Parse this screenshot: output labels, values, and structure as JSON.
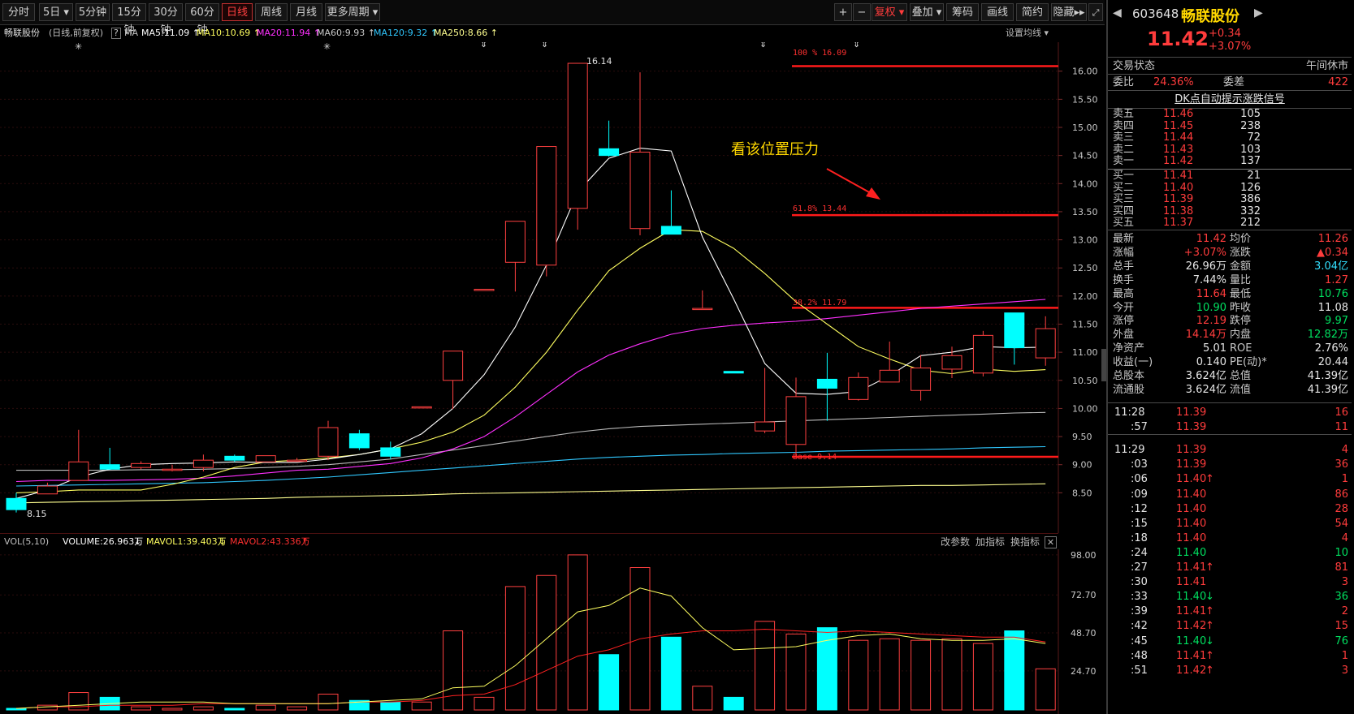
{
  "toolbar": {
    "periods": [
      "分时",
      "5日",
      "5分钟",
      "15分钟",
      "30分钟",
      "60分钟",
      "日线",
      "周线",
      "月线",
      "更多周期"
    ],
    "active": "日线",
    "right_buttons": [
      "+",
      "−",
      "复权",
      "叠加",
      "筹码",
      "画线",
      "简约",
      "隐藏"
    ]
  },
  "legend": {
    "stock": "畅联股份",
    "mode": "(日线,前复权)",
    "q": "?",
    "ma": "MA",
    "ma5": "MA5:11.09",
    "ma10": "MA10:10.69",
    "ma20": "MA20:11.94",
    "ma60": "MA60:9.93",
    "ma120": "MA120:9.32",
    "ma250": "MA250:8.66",
    "setting": "设置均线"
  },
  "price_axis": [
    "16.00",
    "15.50",
    "15.00",
    "14.50",
    "14.00",
    "13.50",
    "13.00",
    "12.50",
    "12.00",
    "11.50",
    "11.00",
    "10.50",
    "10.00",
    "9.50",
    "9.00",
    "8.50"
  ],
  "annotations": {
    "high": "16.14",
    "low": "8.15",
    "note": "看该位置压力",
    "fib100": "100 % 16.09",
    "fib618": "61.8% 13.44",
    "fib382": "38.2% 11.79",
    "base": "Base  9.14"
  },
  "colors": {
    "up": "#ff4040",
    "down": "#00ffff",
    "ma5": "#ffffff",
    "ma10": "#ffff60",
    "ma20": "#ff30ff",
    "ma60": "#bbbbbb",
    "ma120": "#30c8ff",
    "ma250": "#ffff90"
  },
  "chart_data": {
    "type": "candlestick",
    "candles": [
      {
        "o": 8.4,
        "h": 8.5,
        "l": 8.15,
        "c": 8.2
      },
      {
        "o": 8.48,
        "h": 8.68,
        "l": 8.48,
        "c": 8.62
      },
      {
        "o": 8.72,
        "h": 9.62,
        "l": 8.72,
        "c": 9.05
      },
      {
        "o": 9.0,
        "h": 9.3,
        "l": 8.92,
        "c": 8.92
      },
      {
        "o": 8.95,
        "h": 9.06,
        "l": 8.92,
        "c": 9.02
      },
      {
        "o": 8.9,
        "h": 9.0,
        "l": 8.88,
        "c": 8.92
      },
      {
        "o": 8.95,
        "h": 9.18,
        "l": 8.88,
        "c": 9.08
      },
      {
        "o": 9.15,
        "h": 9.18,
        "l": 9.05,
        "c": 9.08
      },
      {
        "o": 9.05,
        "h": 9.16,
        "l": 9.05,
        "c": 9.16
      },
      {
        "o": 9.06,
        "h": 9.12,
        "l": 9.05,
        "c": 9.08
      },
      {
        "o": 9.15,
        "h": 9.78,
        "l": 9.08,
        "c": 9.66
      },
      {
        "o": 9.55,
        "h": 9.62,
        "l": 9.26,
        "c": 9.3
      },
      {
        "o": 9.3,
        "h": 9.41,
        "l": 9.1,
        "c": 9.15
      },
      {
        "o": 10.03,
        "h": 10.03,
        "l": 10.03,
        "c": 10.03
      },
      {
        "o": 10.5,
        "h": 11.02,
        "l": 9.99,
        "c": 11.02
      },
      {
        "o": 12.1,
        "h": 12.1,
        "l": 12.1,
        "c": 12.12
      },
      {
        "o": 12.6,
        "h": 13.33,
        "l": 12.08,
        "c": 13.33
      },
      {
        "o": 12.55,
        "h": 14.66,
        "l": 12.35,
        "c": 14.66
      },
      {
        "o": 13.56,
        "h": 16.14,
        "l": 13.18,
        "c": 16.14
      },
      {
        "o": 14.62,
        "h": 15.12,
        "l": 14.48,
        "c": 14.5
      },
      {
        "o": 13.2,
        "h": 15.98,
        "l": 13.08,
        "c": 14.56
      },
      {
        "o": 13.24,
        "h": 13.88,
        "l": 13.1,
        "c": 13.1
      },
      {
        "o": 11.78,
        "h": 12.1,
        "l": 11.78,
        "c": 11.78
      },
      {
        "o": 10.66,
        "h": 10.66,
        "l": 10.63,
        "c": 10.63
      },
      {
        "o": 9.6,
        "h": 10.72,
        "l": 9.56,
        "c": 9.76
      },
      {
        "o": 9.36,
        "h": 10.55,
        "l": 9.15,
        "c": 10.21
      },
      {
        "o": 10.52,
        "h": 10.99,
        "l": 9.78,
        "c": 10.36
      },
      {
        "o": 10.16,
        "h": 10.64,
        "l": 10.14,
        "c": 10.55
      },
      {
        "o": 10.47,
        "h": 11.19,
        "l": 10.47,
        "c": 10.68
      },
      {
        "o": 10.32,
        "h": 10.95,
        "l": 10.14,
        "c": 10.72
      },
      {
        "o": 10.7,
        "h": 11.1,
        "l": 10.54,
        "c": 10.94
      },
      {
        "o": 10.63,
        "h": 11.38,
        "l": 10.57,
        "c": 11.3
      },
      {
        "o": 11.7,
        "h": 11.7,
        "l": 10.78,
        "c": 11.08
      },
      {
        "o": 10.9,
        "h": 11.64,
        "l": 10.76,
        "c": 11.42
      }
    ],
    "ma5": [
      8.4,
      8.55,
      8.78,
      8.92,
      9.0,
      9.02,
      9.03,
      9.05,
      9.04,
      9.04,
      9.1,
      9.18,
      9.28,
      9.55,
      10.0,
      10.6,
      11.45,
      12.55,
      13.85,
      14.45,
      14.63,
      14.58,
      13.05,
      11.95,
      10.8,
      10.27,
      10.25,
      10.3,
      10.58,
      10.94,
      11.0,
      11.1,
      11.08,
      11.09
    ],
    "ma10": [
      8.5,
      8.52,
      8.55,
      8.55,
      8.55,
      8.65,
      8.78,
      8.95,
      9.05,
      9.08,
      9.12,
      9.18,
      9.28,
      9.4,
      9.58,
      9.88,
      10.38,
      11.0,
      11.75,
      12.45,
      12.85,
      13.18,
      13.15,
      12.85,
      12.4,
      11.9,
      11.5,
      11.1,
      10.88,
      10.68,
      10.62,
      10.7,
      10.66,
      10.69
    ],
    "ma20": [
      8.7,
      8.72,
      8.72,
      8.72,
      8.73,
      8.74,
      8.76,
      8.8,
      8.85,
      8.9,
      8.92,
      8.97,
      9.02,
      9.12,
      9.28,
      9.5,
      9.85,
      10.25,
      10.65,
      10.95,
      11.15,
      11.32,
      11.42,
      11.48,
      11.52,
      11.55,
      11.6,
      11.66,
      11.72,
      11.78,
      11.82,
      11.86,
      11.9,
      11.94
    ],
    "ma60": [
      8.9,
      8.9,
      8.9,
      8.9,
      8.91,
      8.91,
      8.92,
      8.93,
      8.95,
      8.97,
      9.0,
      9.05,
      9.1,
      9.18,
      9.26,
      9.34,
      9.42,
      9.5,
      9.58,
      9.64,
      9.68,
      9.7,
      9.72,
      9.74,
      9.76,
      9.78,
      9.8,
      9.82,
      9.84,
      9.86,
      9.88,
      9.9,
      9.92,
      9.93
    ],
    "ma120": [
      8.62,
      8.63,
      8.64,
      8.65,
      8.66,
      8.67,
      8.68,
      8.7,
      8.72,
      8.75,
      8.78,
      8.82,
      8.86,
      8.9,
      8.94,
      8.98,
      9.02,
      9.06,
      9.1,
      9.13,
      9.15,
      9.17,
      9.18,
      9.2,
      9.21,
      9.22,
      9.24,
      9.25,
      9.26,
      9.27,
      9.28,
      9.3,
      9.31,
      9.32
    ],
    "ma250": [
      8.32,
      8.33,
      8.34,
      8.35,
      8.36,
      8.37,
      8.38,
      8.39,
      8.4,
      8.42,
      8.43,
      8.44,
      8.45,
      8.46,
      8.48,
      8.49,
      8.5,
      8.51,
      8.52,
      8.53,
      8.54,
      8.55,
      8.56,
      8.57,
      8.58,
      8.59,
      8.6,
      8.61,
      8.62,
      8.63,
      8.63,
      8.64,
      8.65,
      8.66
    ],
    "fib_levels": [
      16.09,
      13.44,
      11.79,
      9.14
    ],
    "price_ylim": [
      8.0,
      16.4
    ],
    "volume_axis": [
      "98.00",
      "72.70",
      "48.70",
      "24.70"
    ],
    "volume_ylim": [
      0,
      100
    ],
    "volume": [
      1,
      3,
      11,
      8,
      2,
      1,
      2,
      1,
      3,
      2,
      10,
      6,
      5,
      5,
      50,
      8,
      78,
      85,
      98,
      35,
      90,
      46,
      15,
      8,
      56,
      48,
      52,
      44,
      45,
      44,
      45,
      42,
      50,
      26
    ],
    "mavol1": [
      1,
      2,
      3,
      4,
      5,
      5,
      5,
      4,
      4,
      4,
      4,
      5,
      6,
      7,
      14,
      15,
      28,
      45,
      62,
      66,
      77,
      72,
      52,
      38,
      39,
      40,
      44,
      47,
      48,
      45,
      44,
      44,
      45,
      42
    ],
    "mavol2": [
      1,
      2,
      2,
      3,
      3,
      3,
      4,
      4,
      4,
      4,
      4,
      5,
      5,
      6,
      9,
      10,
      16,
      25,
      34,
      38,
      45,
      48,
      50,
      50,
      51,
      50,
      49,
      50,
      49,
      48,
      47,
      46,
      46,
      43
    ]
  },
  "volume_legend": {
    "vol": "VOL(5,10)",
    "volume": "VOLUME:26.963万",
    "mavol1": "MAVOL1:39.403万",
    "mavol2": "MAVOL2:43.336万",
    "edit": "改参数",
    "add": "加指标",
    "switch": "换指标",
    "close": "✕"
  },
  "quote": {
    "code": "603648",
    "name": "畅联股份",
    "price": "11.42",
    "change": "+0.34",
    "pct": "+3.07%",
    "status_label": "交易状态",
    "status": "午间休市",
    "wb_label": "委比",
    "wb": "24.36%",
    "wc_label": "委差",
    "wc": "422",
    "signal": "DK点自动提示涨跌信号",
    "asks": [
      {
        "label": "卖五",
        "price": "11.46",
        "vol": "105"
      },
      {
        "label": "卖四",
        "price": "11.45",
        "vol": "238"
      },
      {
        "label": "卖三",
        "price": "11.44",
        "vol": "72"
      },
      {
        "label": "卖二",
        "price": "11.43",
        "vol": "103"
      },
      {
        "label": "卖一",
        "price": "11.42",
        "vol": "137"
      }
    ],
    "bids": [
      {
        "label": "买一",
        "price": "11.41",
        "vol": "21"
      },
      {
        "label": "买二",
        "price": "11.40",
        "vol": "126"
      },
      {
        "label": "买三",
        "price": "11.39",
        "vol": "386"
      },
      {
        "label": "买四",
        "price": "11.38",
        "vol": "332"
      },
      {
        "label": "买五",
        "price": "11.37",
        "vol": "212"
      }
    ],
    "stats": [
      {
        "l1": "最新",
        "v1": "11.42",
        "c1": "red",
        "l2": "均价",
        "v2": "11.26",
        "c2": "red"
      },
      {
        "l1": "涨幅",
        "v1": "+3.07%",
        "c1": "red",
        "l2": "涨跌",
        "v2": "▲0.34",
        "c2": "red"
      },
      {
        "l1": "总手",
        "v1": "26.96万",
        "c1": "wht",
        "l2": "金额",
        "v2": "3.04亿",
        "c2": "cyan"
      },
      {
        "l1": "换手",
        "v1": "7.44%",
        "c1": "wht",
        "l2": "量比",
        "v2": "1.27",
        "c2": "red"
      },
      {
        "l1": "最高",
        "v1": "11.64",
        "c1": "red",
        "l2": "最低",
        "v2": "10.76",
        "c2": "grn"
      },
      {
        "l1": "今开",
        "v1": "10.90",
        "c1": "grn",
        "l2": "昨收",
        "v2": "11.08",
        "c2": "wht"
      },
      {
        "l1": "涨停",
        "v1": "12.19",
        "c1": "red",
        "l2": "跌停",
        "v2": "9.97",
        "c2": "grn"
      },
      {
        "l1": "外盘",
        "v1": "14.14万",
        "c1": "red",
        "l2": "内盘",
        "v2": "12.82万",
        "c2": "grn"
      },
      {
        "l1": "净资产",
        "v1": "5.01",
        "c1": "wht",
        "l2": "ROE",
        "v2": "2.76%",
        "c2": "wht"
      },
      {
        "l1": "收益(一)",
        "v1": "0.140",
        "c1": "wht",
        "l2": "PE(动)*",
        "v2": "20.44",
        "c2": "wht"
      },
      {
        "l1": "总股本",
        "v1": "3.624亿",
        "c1": "wht",
        "l2": "总值",
        "v2": "41.39亿",
        "c2": "wht"
      },
      {
        "l1": "流通股",
        "v1": "3.624亿",
        "c1": "wht",
        "l2": "流值",
        "v2": "41.39亿",
        "c2": "wht"
      }
    ],
    "ticks": [
      {
        "t": "11:28",
        "p": "11.39",
        "v": "16",
        "a": "",
        "c": "red"
      },
      {
        "t": ":57",
        "p": "11.39",
        "v": "11",
        "a": "",
        "c": "red"
      },
      {
        "t": "11:29",
        "p": "11.39",
        "v": "4",
        "a": "",
        "c": "red"
      },
      {
        "t": ":03",
        "p": "11.39",
        "v": "36",
        "a": "",
        "c": "red"
      },
      {
        "t": ":06",
        "p": "11.40",
        "v": "1",
        "a": "↑",
        "c": "red"
      },
      {
        "t": ":09",
        "p": "11.40",
        "v": "86",
        "a": "",
        "c": "red"
      },
      {
        "t": ":12",
        "p": "11.40",
        "v": "28",
        "a": "",
        "c": "red"
      },
      {
        "t": ":15",
        "p": "11.40",
        "v": "54",
        "a": "",
        "c": "red"
      },
      {
        "t": ":18",
        "p": "11.40",
        "v": "4",
        "a": "",
        "c": "red"
      },
      {
        "t": ":24",
        "p": "11.40",
        "v": "10",
        "a": "",
        "c": "grn"
      },
      {
        "t": ":27",
        "p": "11.41",
        "v": "81",
        "a": "↑",
        "c": "red"
      },
      {
        "t": ":30",
        "p": "11.41",
        "v": "3",
        "a": "",
        "c": "red"
      },
      {
        "t": ":33",
        "p": "11.40",
        "v": "36",
        "a": "↓",
        "c": "grn"
      },
      {
        "t": ":39",
        "p": "11.41",
        "v": "2",
        "a": "↑",
        "c": "red"
      },
      {
        "t": ":42",
        "p": "11.42",
        "v": "15",
        "a": "↑",
        "c": "red"
      },
      {
        "t": ":45",
        "p": "11.40",
        "v": "76",
        "a": "↓",
        "c": "grn"
      },
      {
        "t": ":48",
        "p": "11.41",
        "v": "1",
        "a": "↑",
        "c": "red"
      },
      {
        "t": ":51",
        "p": "11.42",
        "v": "3",
        "a": "↑",
        "c": "red"
      }
    ]
  }
}
